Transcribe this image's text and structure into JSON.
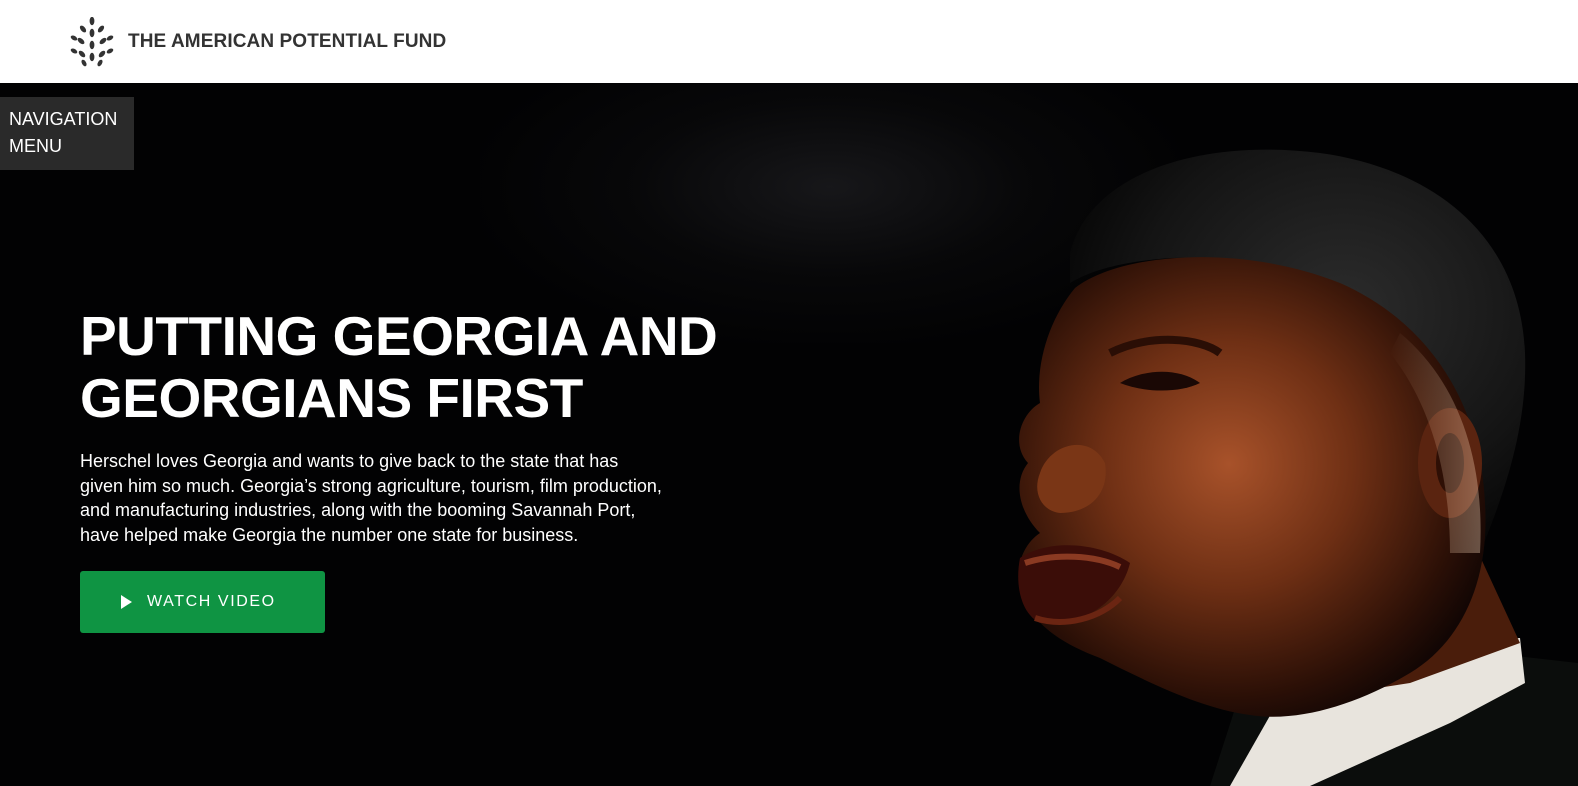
{
  "header": {
    "brand_name": "THE AMERICAN POTENTIAL FUND",
    "logo_icon": "wheat-sprig-icon"
  },
  "nav": {
    "menu_label_line1": "NAVIGATION",
    "menu_label_line2": "MENU"
  },
  "hero": {
    "title_line1": "PUTTING GEORGIA AND",
    "title_line2": "GEORGIANS FIRST",
    "body_lines": [
      "Herschel loves Georgia and wants to give back to the state that has",
      "given him so much. Georgia’s strong agriculture, tourism, film production,",
      "and manufacturing industries, along with the booming Savannah Port,",
      "have helped make Georgia the number one state for business."
    ],
    "cta_label": "WATCH VIDEO",
    "cta_icon": "play-icon"
  },
  "colors": {
    "header_bg": "#ffffff",
    "hero_bg": "#020203",
    "accent_green": "#0f9443",
    "nav_bg": "#2a2a2a"
  }
}
